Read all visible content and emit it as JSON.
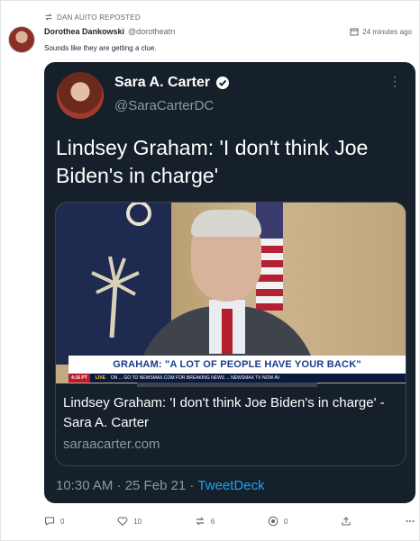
{
  "post": {
    "repost_label": "DAN AUITO REPOSTED",
    "author_name": "Dorothea Dankowski",
    "author_handle": "@dorotheatn",
    "timestamp": "24 minutes ago",
    "text": "Sounds like they are getting a clue."
  },
  "tweet": {
    "name": "Sara A. Carter",
    "handle": "@SaraCarterDC",
    "text": "Lindsey Graham: 'I don't think Joe Biden's in charge'",
    "link_card": {
      "chyron": "GRAHAM: \"A LOT OF PEOPLE HAVE YOUR BACK\"",
      "ticker_time": "4:16 PT",
      "ticker_live": "LIVE",
      "ticker_text": "ON ... GO TO NEWSMAX.COM FOR BREAKING NEWS ... NEWSMAX TV NOW AV",
      "title": "Lindsey Graham: 'I don't think Joe Biden's in charge' - Sara A. Carter",
      "domain": "saraacarter.com"
    },
    "time": "10:30 AM · 25 Feb 21 ·",
    "client": "TweetDeck"
  },
  "actions": {
    "comments": "0",
    "likes": "10",
    "reposts": "6",
    "views": "0"
  },
  "colors": {
    "tweet_bg": "#15202b",
    "accent": "#1da1f2",
    "meta_text": "#8899a6"
  }
}
